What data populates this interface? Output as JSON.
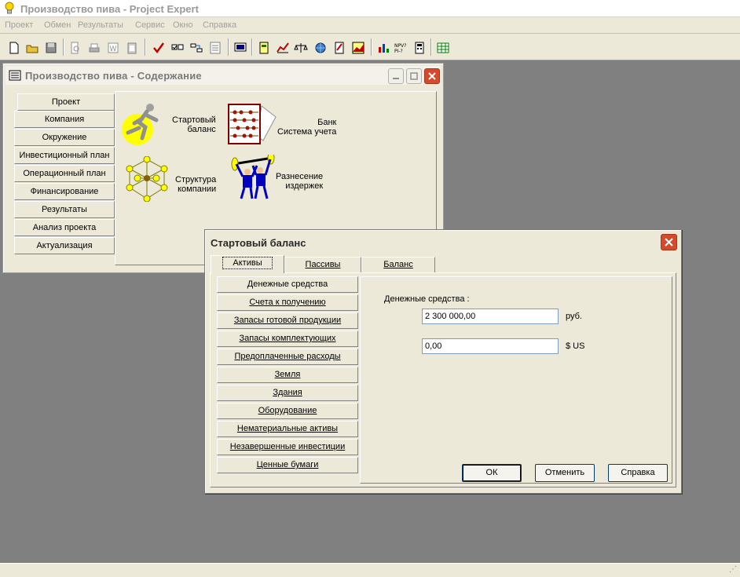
{
  "app": {
    "title": "Производство пива - Project Expert",
    "menu": [
      "Проект",
      "Обмен",
      "Результаты",
      "Сервис",
      "Окно",
      "Справка"
    ]
  },
  "content_window": {
    "title": "Производство пива - Содержание",
    "tabs": [
      "Проект",
      "Компания",
      "Окружение",
      "Инвестиционный план",
      "Операционный план",
      "Финансирование",
      "Результаты",
      "Анализ проекта",
      "Актуализация"
    ],
    "active_tab": "Проект",
    "items": {
      "starting_balance": "Стартовый\nбаланс",
      "accounting": "Банк\nСистема учета",
      "company_structure": "Структура\nкомпании",
      "cost_allocation": "Разнесение\nиздержек"
    }
  },
  "dialog": {
    "title": "Стартовый баланс",
    "tabs": [
      "Активы",
      "Пассивы",
      "Баланс"
    ],
    "active_tab": "Активы",
    "assets": [
      "Денежные средства",
      "Счета к получению",
      "Запасы готовой продукции",
      "Запасы комплектующих",
      "Предоплаченные расходы",
      "Земля",
      "Здания",
      "Оборудование",
      "Нематериальные активы",
      "Незавершенные инвестиции",
      "Ценные бумаги"
    ],
    "active_asset": "Денежные средства",
    "detail": {
      "heading": "Денежные средства :",
      "rub_value": "2 300 000,00",
      "rub_unit": "руб.",
      "usd_value": "0,00",
      "usd_unit": "$ US"
    },
    "buttons": {
      "ok": "ОК",
      "cancel": "Отменить",
      "help": "Справка"
    }
  },
  "status": {
    "grip": "⋰"
  },
  "colors": {
    "desktop": "#808080",
    "face": "#ece9d8",
    "close": "#d44a2a",
    "input_border": "#7f9db9"
  }
}
